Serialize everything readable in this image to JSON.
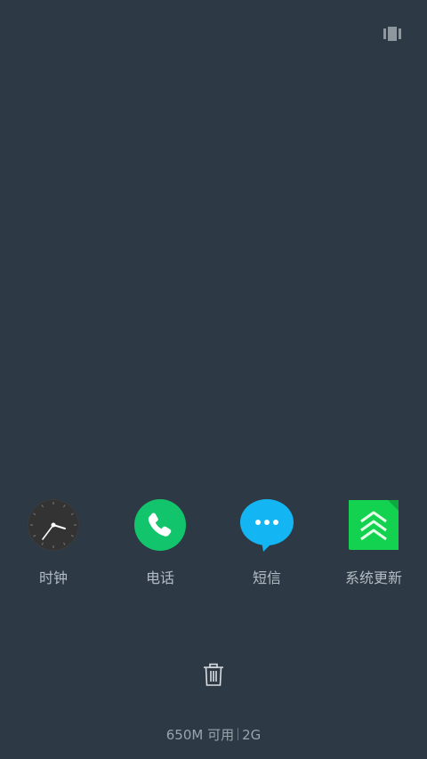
{
  "top": {
    "icon": "multiwindow-icon"
  },
  "apps": [
    {
      "label": "时钟",
      "icon": "clock-icon"
    },
    {
      "label": "电话",
      "icon": "phone-icon",
      "color": "#12c46b"
    },
    {
      "label": "短信",
      "icon": "message-icon",
      "color": "#13b6f3"
    },
    {
      "label": "系统更新",
      "icon": "system-update-icon",
      "color": "#12d24f"
    }
  ],
  "bottom": {
    "trash_icon": "trash-icon",
    "memory_text": "650M 可用",
    "network_text": "2G"
  }
}
